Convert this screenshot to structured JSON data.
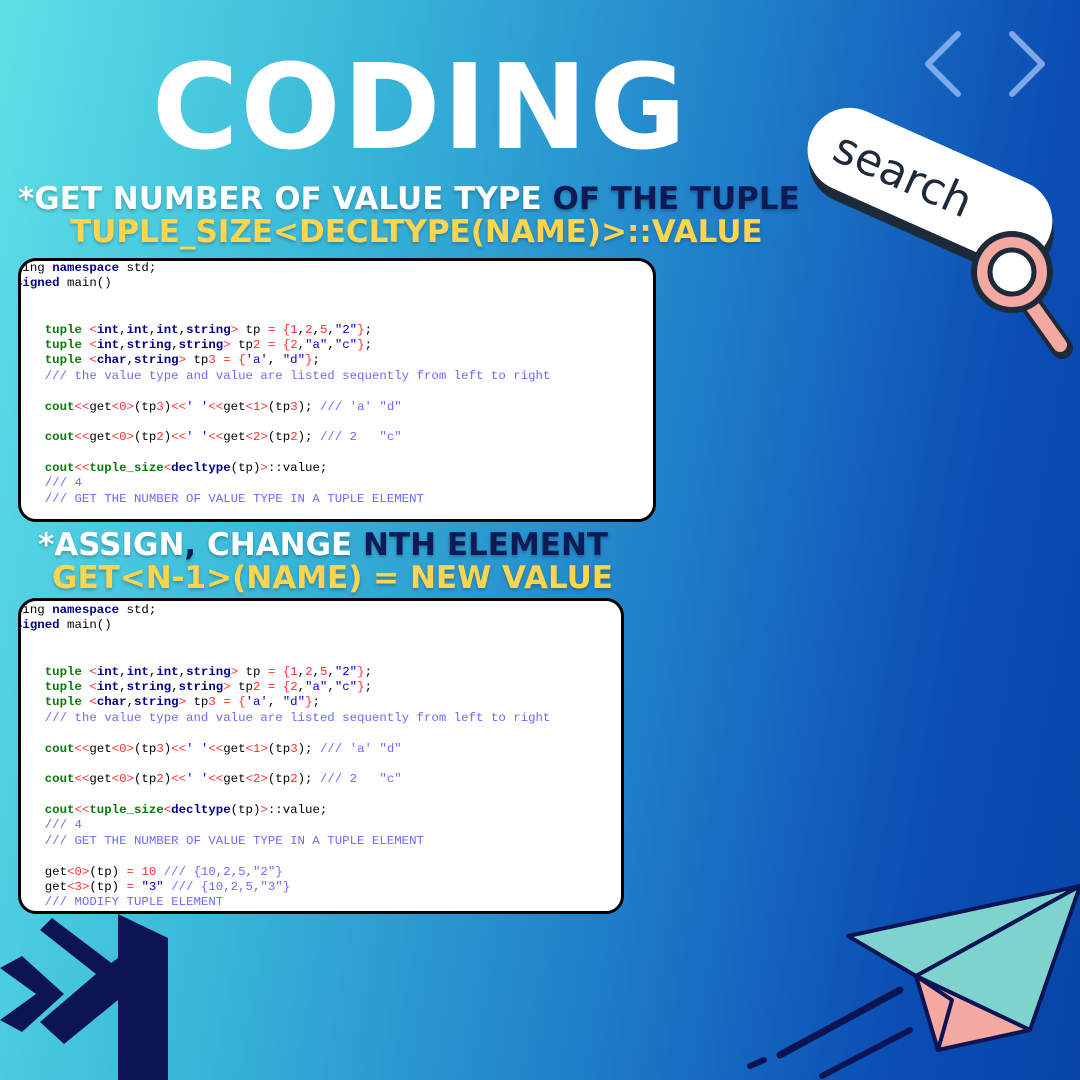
{
  "title": "CODING",
  "section1": {
    "heading_prefix": "*GET NUMBER OF VALUE TYPE",
    "heading_suffix": " OF THE TUPLE",
    "subheading": "TUPLE_SIZE<DECLTYPE(NAME)>::VALUE"
  },
  "section2": {
    "heading_prefix": "*ASSIGN",
    "heading_comma": ",",
    "heading_mid": " CHANGE",
    "heading_suffix": " NTH ELEMENT",
    "subheading": "GET<N-1>(NAME) = NEW VALUE"
  },
  "code1": {
    "lines": [
      "sing namespace std;",
      "signed main()",
      "{",
      "",
      "    tuple <int,int,int,string> tp = {1,2,5,\"2\"};",
      "    tuple <int,string,string> tp2 = {2,\"a\",\"c\"};",
      "    tuple <char,string> tp3 = {'a', \"d\"};",
      "    /// the value type and value are listed sequently from left to right",
      "",
      "    cout<<get<0>(tp3)<<' '<<get<1>(tp3); /// 'a' \"d\"",
      "",
      "    cout<<get<0>(tp2)<<' '<<get<2>(tp2); /// 2   \"c\"",
      "",
      "    cout<<tuple_size<decltype(tp)>::value;",
      "    /// 4",
      "    /// GET THE NUMBER OF VALUE TYPE IN A TUPLE ELEMENT"
    ]
  },
  "code2": {
    "lines": [
      "sing namespace std;",
      "signed main()",
      "{",
      "",
      "    tuple <int,int,int,string> tp = {1,2,5,\"2\"};",
      "    tuple <int,string,string> tp2 = {2,\"a\",\"c\"};",
      "    tuple <char,string> tp3 = {'a', \"d\"};",
      "    /// the value type and value are listed sequently from left to right",
      "",
      "    cout<<get<0>(tp3)<<' '<<get<1>(tp3); /// 'a' \"d\"",
      "",
      "    cout<<get<0>(tp2)<<' '<<get<2>(tp2); /// 2   \"c\"",
      "",
      "    cout<<tuple_size<decltype(tp)>::value;",
      "    /// 4",
      "    /// GET THE NUMBER OF VALUE TYPE IN A TUPLE ELEMENT",
      "",
      "    get<0>(tp) = 10 /// {10,2,5,\"2\"}",
      "    get<3>(tp) = \"3\" /// {10,2,5,\"3\"}",
      "    /// MODIFY TUPLE ELEMENT"
    ]
  },
  "decor": {
    "search_text": "search",
    "icons": [
      "chevron-left-icon",
      "chevron-right-icon",
      "magnifier-icon",
      "visual-studio-logo",
      "paper-plane-icon"
    ]
  },
  "colors": {
    "title": "#ffffff",
    "heading_white": "#ffffff",
    "heading_navy": "#0e1a55",
    "heading_yellow": "#ffd54f",
    "code_bg": "#ffffff"
  }
}
